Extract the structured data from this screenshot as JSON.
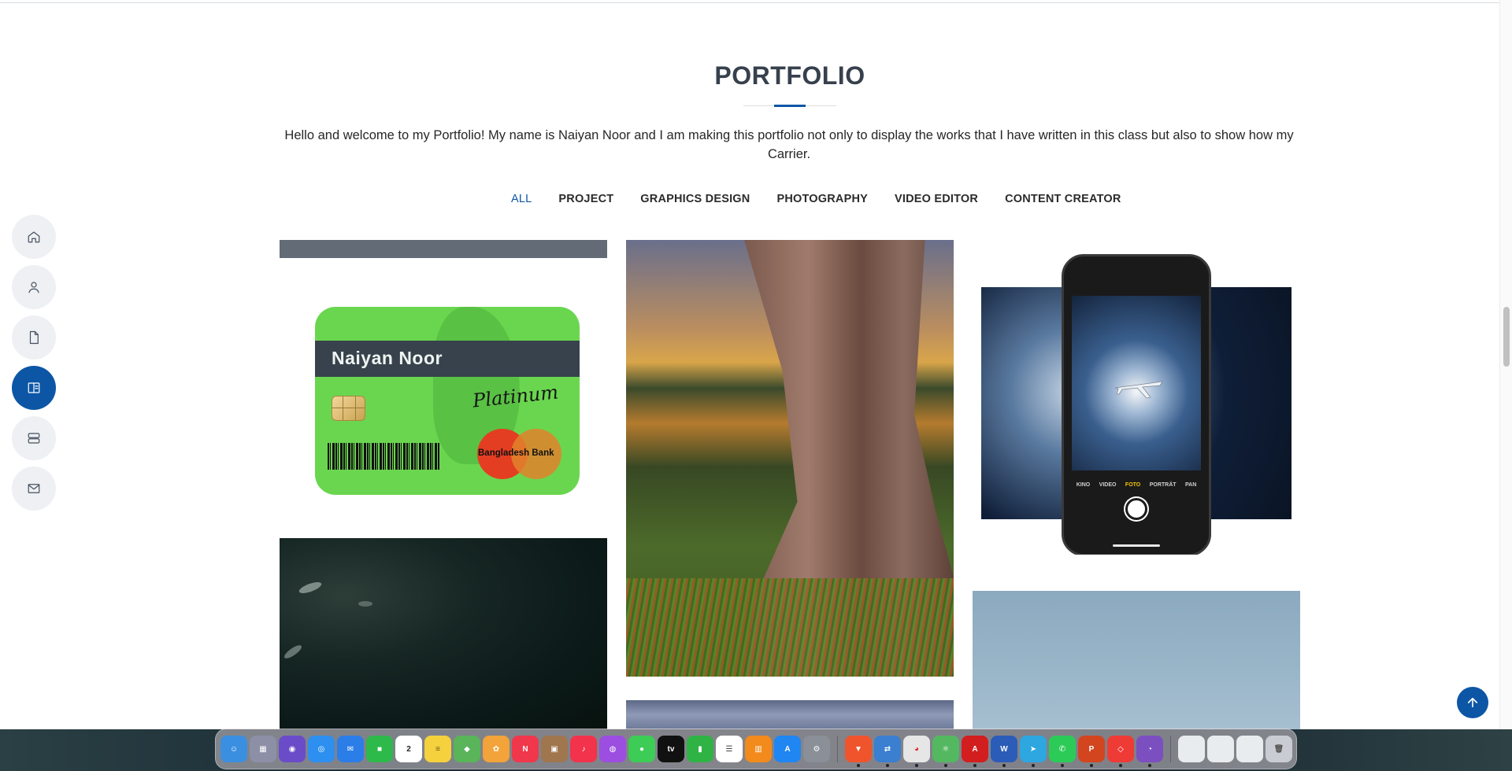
{
  "section": {
    "title": "PORTFOLIO",
    "intro": "Hello and welcome to my Portfolio! My name is Naiyan Noor and I am making this portfolio not only to display the works that I have written in this class but also to show how my Carrier."
  },
  "filters": [
    {
      "label": "ALL",
      "active": true
    },
    {
      "label": "PROJECT"
    },
    {
      "label": "GRAPHICS DESIGN"
    },
    {
      "label": "PHOTOGRAPHY"
    },
    {
      "label": "VIDEO EDITOR"
    },
    {
      "label": "CONTENT CREATOR"
    }
  ],
  "side_nav": {
    "items": [
      {
        "icon": "home-icon"
      },
      {
        "icon": "user-icon"
      },
      {
        "icon": "document-icon"
      },
      {
        "icon": "portfolio-icon",
        "active": true
      },
      {
        "icon": "server-icon"
      },
      {
        "icon": "mail-icon"
      }
    ]
  },
  "card_graphic": {
    "name": "Naiyan Noor",
    "script": "Platinum",
    "bank": "Bangladesh Bank"
  },
  "phone_mockup": {
    "modes": [
      "KINO",
      "VIDEO",
      "FOTO",
      "PORTRÄT",
      "PAN"
    ],
    "active_mode": "FOTO"
  },
  "colors": {
    "accent": "#0d56a6",
    "title": "#37404d"
  },
  "dock": {
    "apps": [
      {
        "name": "Finder",
        "color": "#3b8fe0",
        "glyph": "☺"
      },
      {
        "name": "Launchpad",
        "color": "#8c8fa6",
        "glyph": "▦"
      },
      {
        "name": "Siri",
        "color": "#6a4cc9",
        "glyph": "◉"
      },
      {
        "name": "Safari",
        "color": "#2d8ff0",
        "glyph": "◎"
      },
      {
        "name": "Mail",
        "color": "#2b7de8",
        "glyph": "✉"
      },
      {
        "name": "FaceTime",
        "color": "#2dba4a",
        "glyph": "■"
      },
      {
        "name": "Calendar",
        "color": "#ffffff",
        "glyph": "2",
        "text": "#222"
      },
      {
        "name": "Notes",
        "color": "#f4d13d",
        "glyph": "≡",
        "text": "#6b5a1a"
      },
      {
        "name": "Maps",
        "color": "#59b45a",
        "glyph": "◆"
      },
      {
        "name": "Photos",
        "color": "#f2a33a",
        "glyph": "✿"
      },
      {
        "name": "News",
        "color": "#f0374b",
        "glyph": "N"
      },
      {
        "name": "Archive",
        "color": "#a0764e",
        "glyph": "▣"
      },
      {
        "name": "Music",
        "color": "#f2334b",
        "glyph": "♪"
      },
      {
        "name": "Podcasts",
        "color": "#9b4ee0",
        "glyph": "◍"
      },
      {
        "name": "Messages",
        "color": "#3dcc55",
        "glyph": "●"
      },
      {
        "name": "TV",
        "color": "#111111",
        "glyph": "tv"
      },
      {
        "name": "Numbers",
        "color": "#2fb344",
        "glyph": "▮"
      },
      {
        "name": "Reminders",
        "color": "#ffffff",
        "glyph": "☰",
        "text": "#444"
      },
      {
        "name": "Books",
        "color": "#f28a1c",
        "glyph": "▥"
      },
      {
        "name": "App Store",
        "color": "#1f86f2",
        "glyph": "A"
      },
      {
        "name": "Settings",
        "color": "#8a8f98",
        "glyph": "⚙"
      },
      {
        "sep": true
      },
      {
        "name": "Brave",
        "color": "#f0542c",
        "glyph": "▼",
        "dot": true
      },
      {
        "name": "Migration",
        "color": "#3a7fd0",
        "glyph": "⇄",
        "dot": true
      },
      {
        "name": "Chrome",
        "color": "#e6e6e6",
        "glyph": "◕",
        "text": "#d33",
        "dot": true
      },
      {
        "name": "Atom",
        "color": "#53b860",
        "glyph": "⚛",
        "dot": true
      },
      {
        "name": "Acrobat",
        "color": "#d21e1e",
        "glyph": "A",
        "dot": true
      },
      {
        "name": "Word",
        "color": "#2b5cb8",
        "glyph": "W",
        "dot": true
      },
      {
        "name": "Telegram",
        "color": "#2ea6e0",
        "glyph": "➤",
        "dot": true
      },
      {
        "name": "WhatsApp",
        "color": "#2ccb58",
        "glyph": "✆",
        "dot": true
      },
      {
        "name": "PowerPoint",
        "color": "#d2451e",
        "glyph": "P",
        "dot": true
      },
      {
        "name": "AnyDesk",
        "color": "#ef3b35",
        "glyph": "◇",
        "dot": true
      },
      {
        "name": "GitHub",
        "color": "#7b4fc0",
        "glyph": "◔",
        "dot": true
      },
      {
        "sep": true
      },
      {
        "name": "Window 1",
        "color": "#e9ecef",
        "glyph": "",
        "text": "#333"
      },
      {
        "name": "Window 2",
        "color": "#e9ecef",
        "glyph": "",
        "text": "#333"
      },
      {
        "name": "Window 3",
        "color": "#e9ecef",
        "glyph": "",
        "text": "#333"
      },
      {
        "name": "Trash",
        "color": "#c9ccd2",
        "glyph": "🗑",
        "text": "#555"
      }
    ]
  }
}
